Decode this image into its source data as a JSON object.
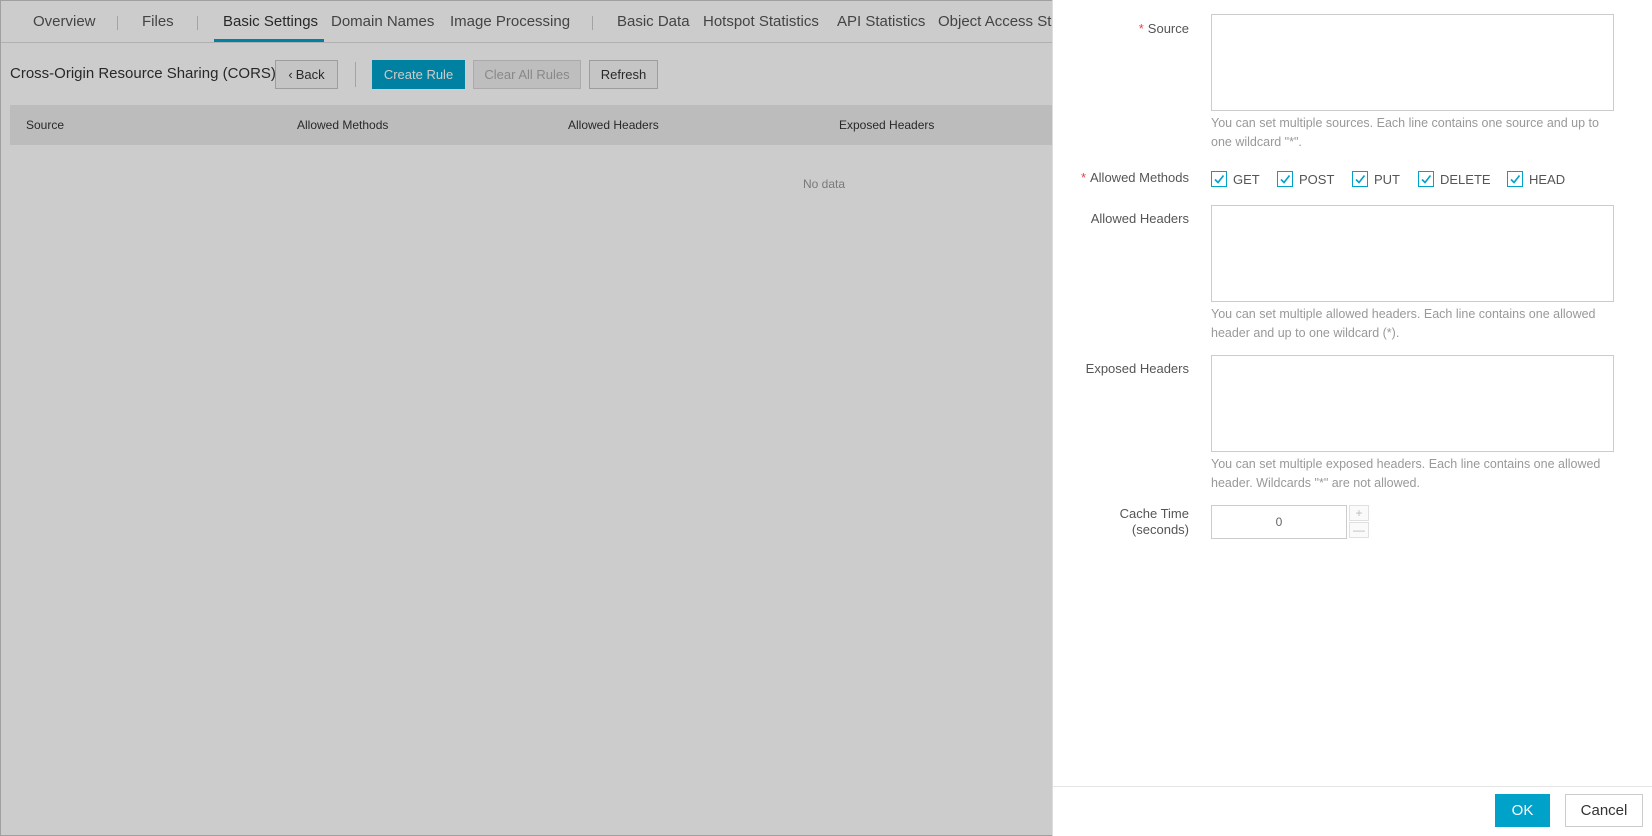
{
  "tabs": [
    {
      "label": "Overview"
    },
    {
      "label": "Files"
    },
    {
      "label": "Basic Settings"
    },
    {
      "label": "Domain Names"
    },
    {
      "label": "Image Processing"
    },
    {
      "label": "Basic Data"
    },
    {
      "label": "Hotspot Statistics"
    },
    {
      "label": "API Statistics"
    },
    {
      "label": "Object Access Sta"
    }
  ],
  "active_tab": "Basic Settings",
  "toolbar": {
    "title": "Cross-Origin Resource Sharing (CORS)",
    "back_label": "Back",
    "create_rule_label": "Create Rule",
    "clear_all_label": "Clear All Rules",
    "refresh_label": "Refresh"
  },
  "table": {
    "columns": [
      "Source",
      "Allowed Methods",
      "Allowed Headers",
      "Exposed Headers"
    ],
    "empty_text": "No data"
  },
  "form": {
    "source": {
      "label": "Source",
      "value": "",
      "hint": "You can set multiple sources. Each line contains one source and up to one wildcard \"*\"."
    },
    "allowed_methods": {
      "label": "Allowed Methods",
      "options": [
        {
          "label": "GET",
          "checked": true
        },
        {
          "label": "POST",
          "checked": true
        },
        {
          "label": "PUT",
          "checked": true
        },
        {
          "label": "DELETE",
          "checked": true
        },
        {
          "label": "HEAD",
          "checked": true
        }
      ]
    },
    "allowed_headers": {
      "label": "Allowed Headers",
      "value": "",
      "hint": "You can set multiple allowed headers. Each line contains one allowed header and up to one wildcard (*)."
    },
    "exposed_headers": {
      "label": "Exposed Headers",
      "value": "",
      "hint": "You can set multiple exposed headers. Each line contains one allowed header. Wildcards \"*\" are not allowed."
    },
    "cache_time": {
      "label_line1": "Cache Time",
      "label_line2": "(seconds)",
      "value": "0",
      "increment": "+",
      "decrement": "—"
    }
  },
  "footer": {
    "ok_label": "OK",
    "cancel_label": "Cancel"
  },
  "colors": {
    "accent": "#00a2ca",
    "required": "#e64545"
  }
}
